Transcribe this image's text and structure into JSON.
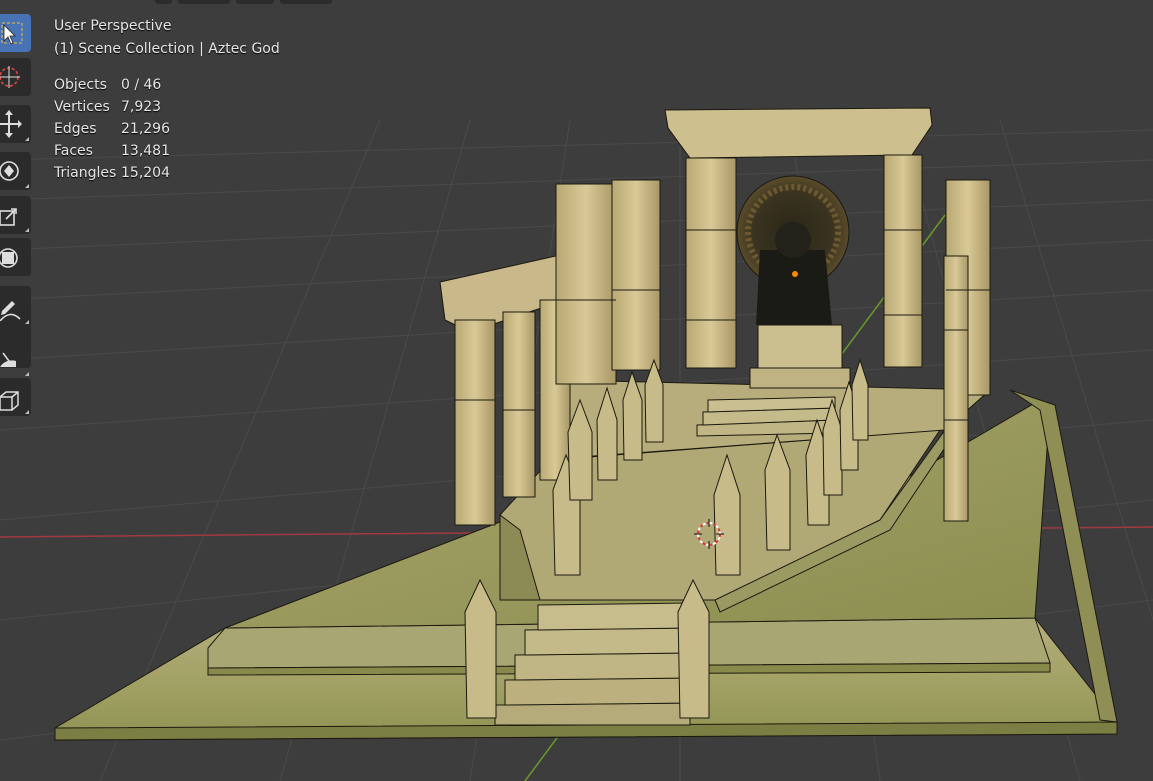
{
  "viewport": {
    "view_name": "User Perspective",
    "collection_info": "(1) Scene Collection | Aztec God"
  },
  "stats": [
    {
      "label": "Objects",
      "value": "0 / 46"
    },
    {
      "label": "Vertices",
      "value": "7,923"
    },
    {
      "label": "Edges",
      "value": "21,296"
    },
    {
      "label": "Faces",
      "value": "13,481"
    },
    {
      "label": "Triangles",
      "value": "15,204"
    }
  ],
  "toolbar": {
    "tools": [
      {
        "name": "select-box-tool",
        "icon": "select-box-icon",
        "active": true
      },
      {
        "name": "cursor-tool",
        "icon": "cursor-icon",
        "active": false
      },
      {
        "name": "move-tool",
        "icon": "move-icon",
        "active": false
      },
      {
        "name": "rotate-tool",
        "icon": "rotate-icon",
        "active": false
      },
      {
        "name": "scale-tool",
        "icon": "scale-icon",
        "active": false
      },
      {
        "name": "transform-tool",
        "icon": "transform-icon",
        "active": false
      },
      {
        "name": "annotate-tool",
        "icon": "annotate-icon",
        "active": false
      },
      {
        "name": "measure-tool",
        "icon": "measure-icon",
        "active": false
      },
      {
        "name": "add-cube-tool",
        "icon": "add-cube-icon",
        "active": false
      }
    ]
  },
  "colors": {
    "background": "#3d3d3d",
    "grid": "#4a4a4a",
    "axis_x": "#a03a42",
    "axis_y": "#6a9a2a",
    "stone": "#c9b98a",
    "moss": "#9aa25a",
    "statue": "#1a1a14",
    "active_tool": "#4772b3"
  }
}
